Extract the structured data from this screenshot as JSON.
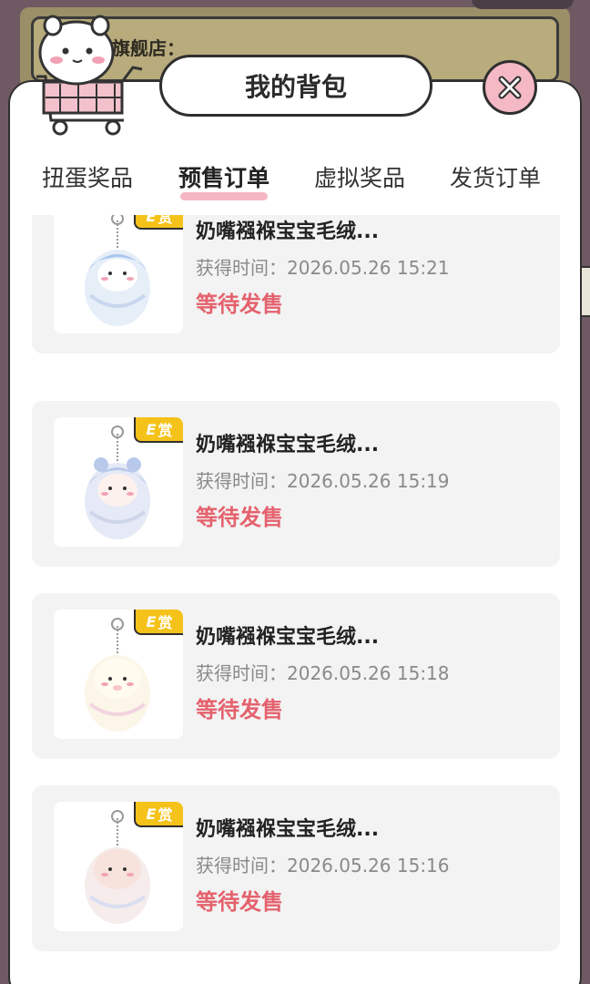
{
  "background": {
    "store_text": "旗舰店："
  },
  "modal": {
    "title": "我的背包",
    "tabs": [
      {
        "label": "扭蛋奖品",
        "active": false
      },
      {
        "label": "预售订单",
        "active": true
      },
      {
        "label": "虚拟奖品",
        "active": false
      },
      {
        "label": "发货订单",
        "active": false
      }
    ]
  },
  "orders": [
    {
      "badge_letter": "E",
      "badge_text": "赏",
      "name": "奶嘴襁褓宝宝毛绒...",
      "time": "获得时间：2026.05.26 15:21",
      "status": "等待发售"
    },
    {
      "badge_letter": "E",
      "badge_text": "赏",
      "name": "奶嘴襁褓宝宝毛绒...",
      "time": "获得时间：2026.05.26 15:19",
      "status": "等待发售"
    },
    {
      "badge_letter": "E",
      "badge_text": "赏",
      "name": "奶嘴襁褓宝宝毛绒...",
      "time": "获得时间：2026.05.26 15:18",
      "status": "等待发售"
    },
    {
      "badge_letter": "E",
      "badge_text": "赏",
      "name": "奶嘴襁褓宝宝毛绒...",
      "time": "获得时间：2026.05.26 15:16",
      "status": "等待发售"
    }
  ],
  "colors": {
    "accent_pink": "#f6b7c2",
    "status_red": "#e4626d",
    "badge_yellow": "#f5c21a"
  }
}
